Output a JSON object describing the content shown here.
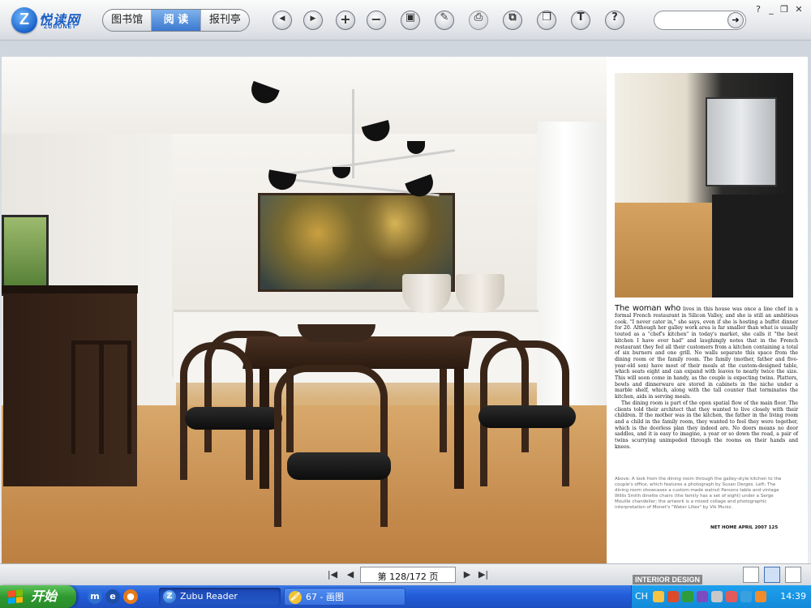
{
  "toolbar": {
    "logo_mark": "Z",
    "logo_text": "悦读网",
    "logo_sub": "ZUBUNET",
    "tabs": [
      {
        "label": "图书馆"
      },
      {
        "label": "阅 读"
      },
      {
        "label": "报刊亭"
      }
    ],
    "buttons": [
      {
        "name": "prev-page-button",
        "icon": "left-arrow-icon",
        "glyph": "◀"
      },
      {
        "name": "next-page-button",
        "icon": "right-arrow-icon",
        "glyph": "▶"
      },
      {
        "name": "zoom-in-button",
        "icon": "plus-icon",
        "glyph": "+"
      },
      {
        "name": "zoom-out-button",
        "icon": "minus-icon",
        "glyph": "−"
      },
      {
        "name": "bookmark-button",
        "icon": "book-icon",
        "glyph": "▣"
      },
      {
        "name": "annotate-button",
        "icon": "pen-icon",
        "glyph": "✎"
      },
      {
        "name": "print-button",
        "icon": "printer-icon",
        "glyph": "⎙"
      },
      {
        "name": "fit-page-button",
        "icon": "fit-icon",
        "glyph": "⧉"
      },
      {
        "name": "copy-button",
        "icon": "copy-icon",
        "glyph": "❐"
      },
      {
        "name": "text-button",
        "icon": "text-icon",
        "glyph": "T"
      },
      {
        "name": "help-button",
        "icon": "help-icon",
        "glyph": "?"
      }
    ],
    "search_placeholder": "",
    "search_go": "➔",
    "window_controls": [
      "?",
      "_",
      "❐",
      "✕"
    ]
  },
  "article": {
    "lead": "The woman who",
    "body": "lives in this house was once a line chef in a formal French restaurant in Silicon Valley, and she is still an ambitious cook. \"I never cater in,\" she says, even if she is hosting a buffet dinner for 20. Although her galley work area is far smaller than what is usually touted as a \"chef's kitchen\" in today's market, she calls it \"the best kitchen I have ever had\" and laughingly notes that in the French restaurant they fed all their customers from a kitchen containing a total of six burners and one grill. No walls separate this space from the dining room or the family room. The family (mother, father and five-year-old son) have most of their meals at the custom-designed table, which seats eight and can expand with leaves to nearly twice the size. This will soon come in handy, as the couple is expecting twins. Platters, bowls and dinnerware are stored in cabinets in the niche under a marble shelf, which, along with the tall counter that terminates the kitchen, aids in serving meals.",
    "body2": "The dining room is part of the open spatial flow of the main floor. The clients told their architect that they wanted to live closely with their children. If the mother was in the kitchen, the father in the living room and a child in the family room, they wanted to feel they were together, which is the doorless plan they indeed are. No doors means no door saddles, and it is easy to imagine, a year or so down the road, a pair of twins scurrying unimpeded through the rooms on their hands and knees.",
    "caption": "Above: A look from the dining room through the galley-style kitchen to the couple's office, which features a photograph by Susan Derges. Left: The dining room showcases a custom-made walnut Parsons table and vintage Willis Smith dinette chairs (the family has a set of eight) under a Serge Mouille chandelier; the artwork is a mixed collage and photographic interpretation of Monet's \"Water Lilies\" by Vik Muniz.",
    "folio": "NET HOME APRIL 2007 125"
  },
  "pager": {
    "first": "|◀",
    "prev": "◀",
    "page_text": "第 128/172 页",
    "next": "▶",
    "last": "▶|",
    "watermark": "INTERIOR DESIGN"
  },
  "taskbar": {
    "start_label": "开始",
    "tasks": [
      {
        "label": "Zubu Reader",
        "state": "active",
        "icon": "Z"
      },
      {
        "label": "67 - 画图",
        "state": "idle",
        "icon": "🖌"
      }
    ],
    "tray_lang": "CH",
    "clock": "14:39"
  },
  "colors": {
    "accent": "#3b78cf",
    "taskbar": "#245edb",
    "start_green": "#2f9a2f"
  }
}
